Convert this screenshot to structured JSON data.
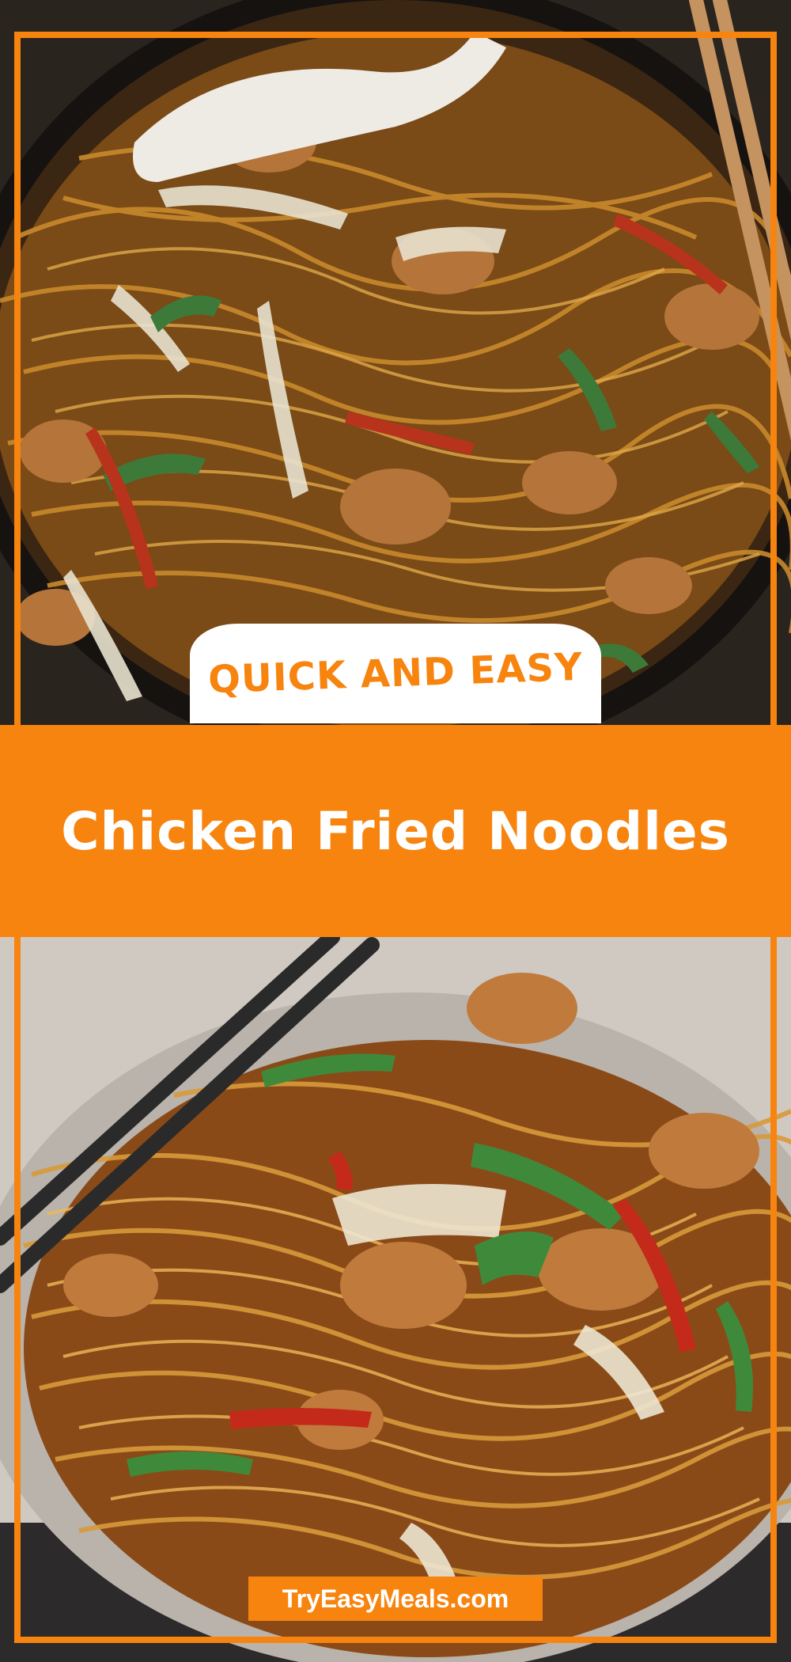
{
  "badge": {
    "label": "QUICK AND EASY"
  },
  "title": {
    "text": "Chicken Fried Noodles"
  },
  "site": {
    "label": "TryEasyMeals.com"
  },
  "colors": {
    "accent": "#f7840f",
    "text_on_accent": "#ffffff",
    "badge_bg": "#ffffff"
  }
}
